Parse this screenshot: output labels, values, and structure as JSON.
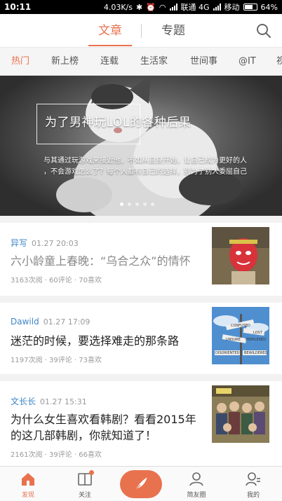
{
  "status_bar": {
    "time": "10:11",
    "speed": "4.03K/s",
    "carrier1": "联通 4G",
    "carrier2": "移动",
    "battery": "64%"
  },
  "top_nav": {
    "tabs": [
      {
        "label": "文章",
        "active": true
      },
      {
        "label": "专题",
        "active": false
      }
    ],
    "search_icon": "search-icon"
  },
  "categories": [
    {
      "label": "热门",
      "active": true
    },
    {
      "label": "新上榜"
    },
    {
      "label": "连载"
    },
    {
      "label": "生活家"
    },
    {
      "label": "世间事"
    },
    {
      "label": "@IT"
    },
    {
      "label": "视"
    }
  ],
  "banner": {
    "title": "为了男神玩LOL的各种后果",
    "desc_line1": "与其通过玩游戏来接近他，不如从自身开始，让自己成为更好的人",
    "desc_line2": "，不会游戏怎么了？每个人都有自己的选择，别为了别人委屈自己",
    "slide_count": 5,
    "active_slide": 0
  },
  "articles": [
    {
      "author": "异写",
      "time": "01.27 20:03",
      "title": "六小龄童上春晚：“乌合之众”的情怀",
      "stats": "3163次阅 · 60评论 · 70喜欢",
      "read": true
    },
    {
      "author": "Dawild",
      "time": "01.27 17:09",
      "title": "迷茫的时候，要选择难走的那条路",
      "stats": "1197次阅 · 39评论 · 73喜欢",
      "read": false,
      "sign_words": [
        "CONFUSED",
        "LOST",
        "UNSURE",
        "PERPLEXED",
        "DISORIENTED",
        "BEWILDERED"
      ]
    },
    {
      "author": "文长长",
      "time": "01.27 15:31",
      "title": "为什么女生喜欢看韩剧？看看2015年的这几部韩剧，你就知道了！",
      "stats": "2161次阅 · 39评论 · 66喜欢",
      "read": false
    }
  ],
  "bottom_nav": [
    {
      "label": "发现",
      "icon": "home-icon",
      "active": true
    },
    {
      "label": "关注",
      "icon": "book-icon",
      "badge": true
    },
    {
      "label": "",
      "icon": "quill-icon"
    },
    {
      "label": "简友圈",
      "icon": "friends-icon"
    },
    {
      "label": "我的",
      "icon": "profile-icon"
    }
  ],
  "colors": {
    "accent": "#e8724e",
    "author": "#3f86c8"
  }
}
